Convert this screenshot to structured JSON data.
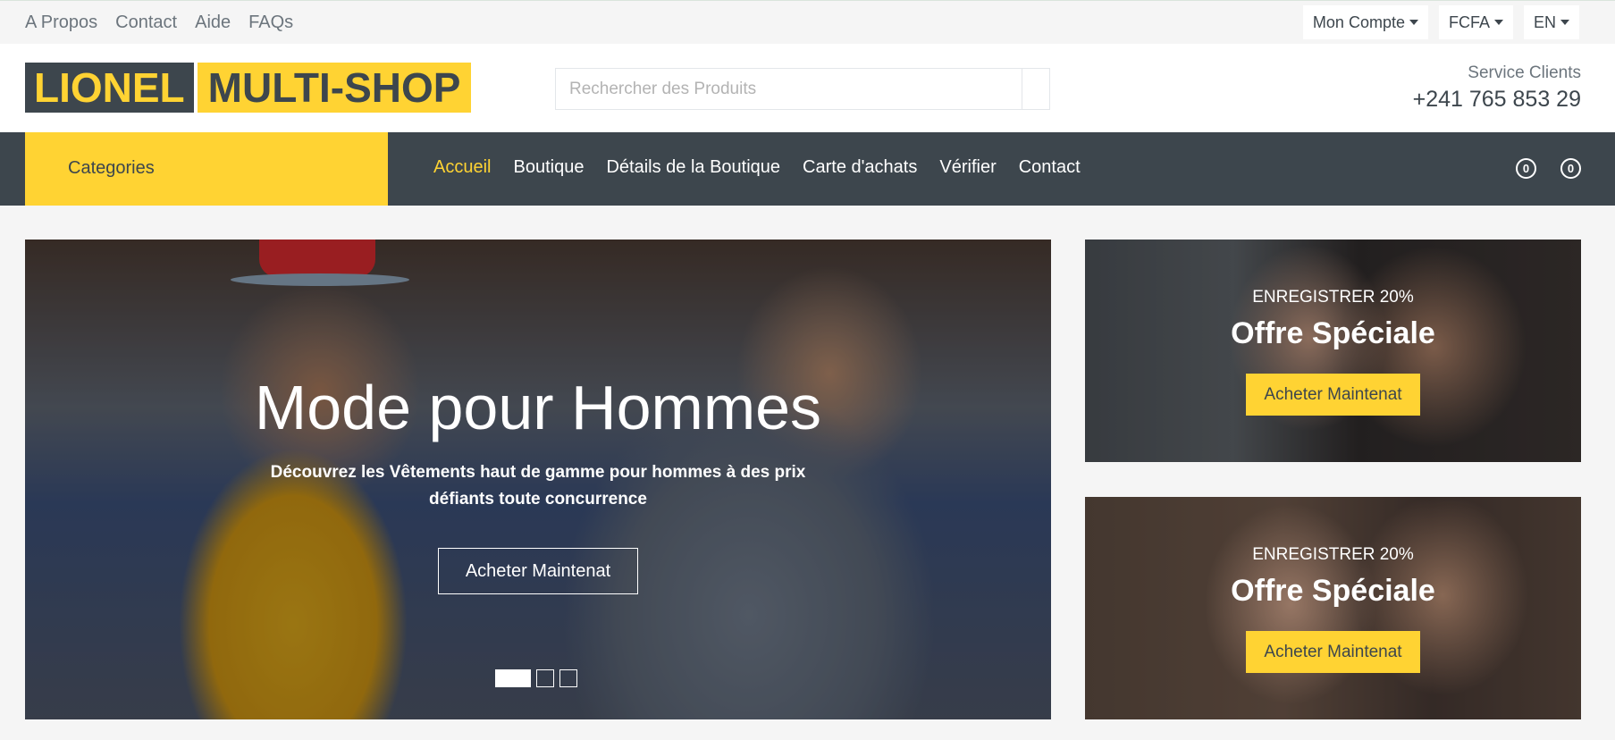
{
  "topbar": {
    "links": [
      "A Propos",
      "Contact",
      "Aide",
      "FAQs"
    ],
    "account_label": "Mon Compte",
    "currency_label": "FCFA",
    "language_label": "EN"
  },
  "header": {
    "logo_part1": "LIONEL",
    "logo_part2": "MULTI-SHOP",
    "search_placeholder": "Rechercher des Produits",
    "service_label": "Service Clients",
    "service_phone": "+241 765 853 29"
  },
  "nav": {
    "categories_label": "Categories",
    "items": [
      "Accueil",
      "Boutique",
      "Détails de la Boutique",
      "Carte d'achats",
      "Vérifier",
      "Contact"
    ],
    "active_item": "Accueil",
    "wishlist_count": "0",
    "cart_count": "0"
  },
  "hero": {
    "title": "Mode pour Hommes",
    "subtitle": "Découvrez les Vêtements haut de gamme pour hommes à des prix défiants toute concurrence",
    "button_label": "Acheter Maintenat",
    "slide_count": 3,
    "active_slide": 1
  },
  "offers": [
    {
      "kicker": "ENREGISTRER 20%",
      "title": "Offre Spéciale",
      "button_label": "Acheter Maintenat"
    },
    {
      "kicker": "ENREGISTRER 20%",
      "title": "Offre Spéciale",
      "button_label": "Acheter Maintenat"
    }
  ],
  "colors": {
    "accent": "#ffd333",
    "dark": "#3d464d"
  }
}
